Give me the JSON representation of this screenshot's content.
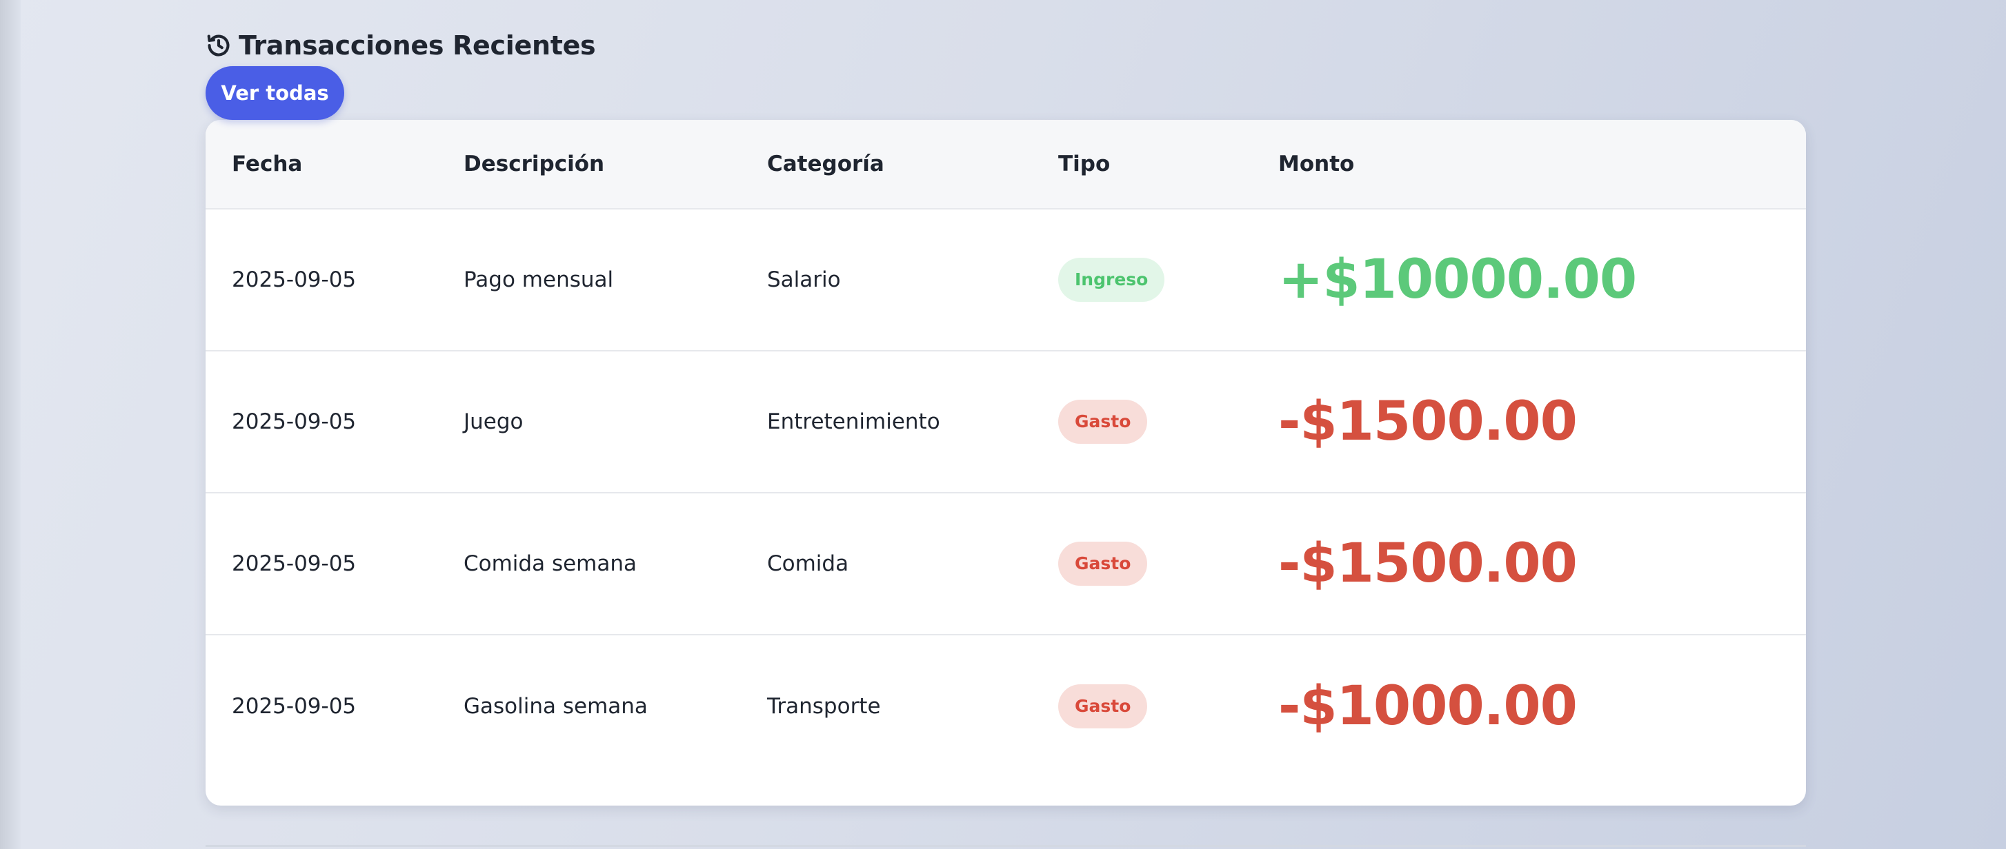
{
  "section": {
    "title": "Transacciones Recientes",
    "icon": "history-icon",
    "view_all_label": "Ver todas"
  },
  "table": {
    "headers": [
      "Fecha",
      "Descripción",
      "Categoría",
      "Tipo",
      "Monto"
    ],
    "rows": [
      {
        "fecha": "2025-09-05",
        "descripcion": "Pago mensual",
        "categoria": "Salario",
        "tipo": "Ingreso",
        "monto": "+$10000.00"
      },
      {
        "fecha": "2025-09-05",
        "descripcion": "Juego",
        "categoria": "Entretenimiento",
        "tipo": "Gasto",
        "monto": "-$1500.00"
      },
      {
        "fecha": "2025-09-05",
        "descripcion": "Comida semana",
        "categoria": "Comida",
        "tipo": "Gasto",
        "monto": "-$1500.00"
      },
      {
        "fecha": "2025-09-05",
        "descripcion": "Gasolina semana",
        "categoria": "Transporte",
        "tipo": "Gasto",
        "monto": "-$1000.00"
      }
    ]
  },
  "colors": {
    "accent": "#4a5ee6",
    "income": "#5cc97a",
    "expense": "#d5503f",
    "income_badge_bg": "#e2f6e8",
    "expense_badge_bg": "#f8ddd9"
  }
}
